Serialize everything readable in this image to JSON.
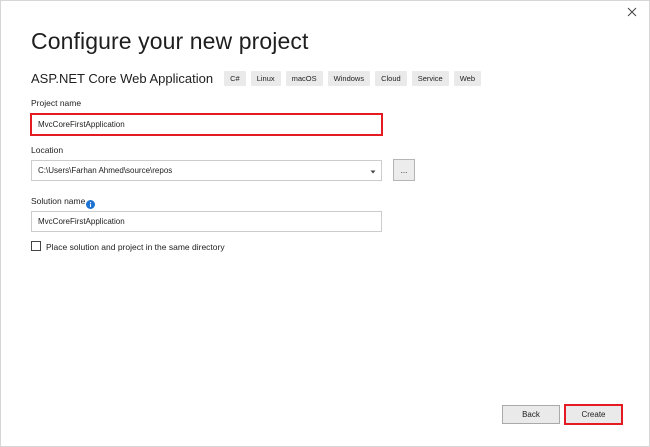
{
  "dialog": {
    "title": "Configure your new project",
    "close_icon": "close-icon"
  },
  "template": {
    "name": "ASP.NET Core Web Application",
    "tags": [
      "C#",
      "Linux",
      "macOS",
      "Windows",
      "Cloud",
      "Service",
      "Web"
    ]
  },
  "project_name": {
    "label": "Project name",
    "value": "MvcCoreFirstApplication"
  },
  "location": {
    "label": "Location",
    "value": "C:\\Users\\Farhan Ahmed\\source\\repos",
    "browse_label": "..."
  },
  "solution_name": {
    "label": "Solution name",
    "value": "MvcCoreFirstApplication",
    "info_icon": "info-icon"
  },
  "same_directory": {
    "label": "Place solution and project in the same directory",
    "checked": false
  },
  "buttons": {
    "back": "Back",
    "create": "Create"
  },
  "colors": {
    "accent_highlight": "#e51b24",
    "info_blue": "#1e73d2",
    "tag_bg": "#eaeaea"
  }
}
